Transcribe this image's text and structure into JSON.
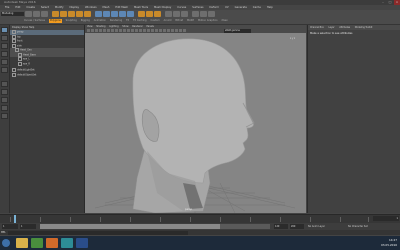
{
  "window": {
    "title": "Autodesk Maya 2016"
  },
  "menubar": {
    "items": [
      "File",
      "Edit",
      "Create",
      "Select",
      "Modify",
      "Display",
      "Windows",
      "Mesh",
      "Edit Mesh",
      "Mesh Tools",
      "Mesh Display",
      "Curves",
      "Surfaces",
      "Deform",
      "UV",
      "Generate",
      "Cache",
      "Help"
    ]
  },
  "shelf": {
    "mode": "Modeling",
    "tabs": [
      "Curves / Surfaces",
      "Polygons",
      "Sculpting",
      "Rigging",
      "Animation",
      "Rendering",
      "FX",
      "FX Caching",
      "Custom",
      "Arnold",
      "Bifrost",
      "MASH",
      "Motion Graphics",
      "XGen"
    ],
    "active_tab": "Polygons"
  },
  "outliner": {
    "header": "Display  Show  Help",
    "rows": [
      "persp",
      "top",
      "front",
      "side",
      "Head_Geo",
      "Head_Base",
      "eye_L",
      "eye_R",
      "defaultLightSet",
      "defaultObjectSet"
    ]
  },
  "viewport": {
    "menus": [
      "View",
      "Shading",
      "Lighting",
      "Show",
      "Renderer",
      "Panels"
    ],
    "gamma_field": "sRGB gamma",
    "camera_label": "persp",
    "grid_label": "x y z",
    "colors": {
      "background": "#858585",
      "head": "#b0b0b0"
    }
  },
  "rightpanel": {
    "tabs": [
      "Channel Box",
      "Layer",
      "Attributes",
      "Modeling Toolkit"
    ],
    "title": "Make a selection to see attributes"
  },
  "timeline": {
    "current_frame": "1",
    "range_label": "1"
  },
  "rangebar": {
    "start": "1",
    "start2": "1",
    "end": "120",
    "end2": "200",
    "anim_layer": "No Anim Layer",
    "char_set": "No Character Set"
  },
  "cmdline": {
    "label": "MEL"
  },
  "taskbar": {
    "time": "14:27",
    "date": "03.05.2016",
    "apps": [
      "explorer",
      "chrome",
      "firefox",
      "maya",
      "photoshop"
    ]
  }
}
